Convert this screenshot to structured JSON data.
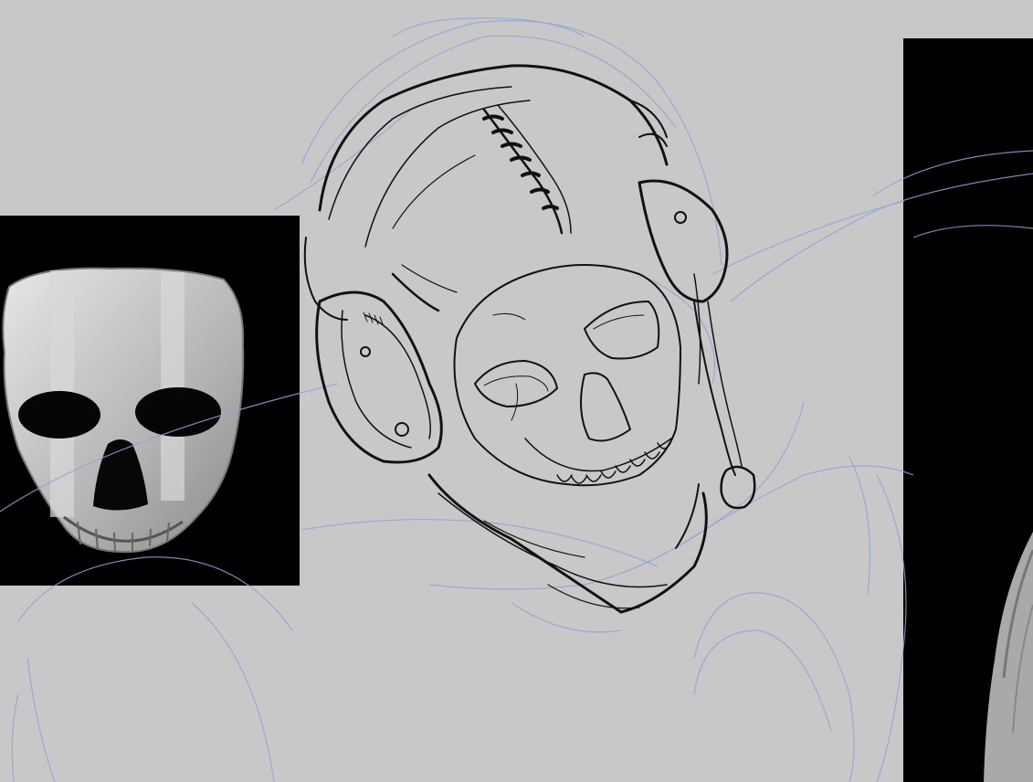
{
  "canvas": {
    "background": "#c8c8c8",
    "sketch_color": "#7f96d6",
    "lineart_color": "#111111"
  },
  "references": {
    "left_image": "skull-mask-photo",
    "right_image": "soldier-reference-photo"
  },
  "icons": {
    "left_ref": "image-icon",
    "right_ref": "image-icon"
  }
}
